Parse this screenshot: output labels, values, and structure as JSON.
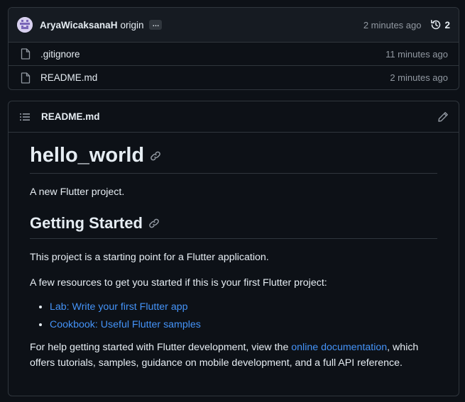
{
  "commit": {
    "author": "AryaWicaksanaH",
    "message": "origin",
    "ellipsis": "…",
    "time": "2 minutes ago",
    "history_count": "2"
  },
  "files": [
    {
      "name": ".gitignore",
      "time": "11 minutes ago",
      "icon": "file-icon"
    },
    {
      "name": "README.md",
      "time": "2 minutes ago",
      "icon": "file-icon"
    }
  ],
  "readme": {
    "header_title": "README.md",
    "h1": "hello_world",
    "p_intro": "A new Flutter project.",
    "h2": "Getting Started",
    "p_start": "This project is a starting point for a Flutter application.",
    "p_resources": "A few resources to get you started if this is your first Flutter project:",
    "links": [
      "Lab: Write your first Flutter app",
      "Cookbook: Useful Flutter samples"
    ],
    "p_help_before": "For help getting started with Flutter development, view the ",
    "p_help_link": "online documentation",
    "p_help_after": ", which offers tutorials, samples, guidance on mobile development, and a full API reference."
  },
  "colors": {
    "background": "#0d1117",
    "panel": "#161b22",
    "border": "#30363d",
    "link": "#4493f8",
    "muted": "#9198a1"
  }
}
